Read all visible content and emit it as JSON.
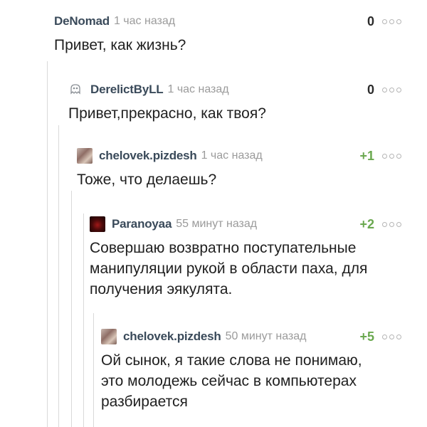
{
  "comments": [
    {
      "username": "DeNomad",
      "time": "1 час назад",
      "rating": "0",
      "text": "Привет, как жизнь?",
      "avatar": "none"
    },
    {
      "username": "DerelictByLL",
      "time": "1 час назад",
      "rating": "0",
      "text": "Привет,прекрасно, как твоя?",
      "avatar": "ghost-icon"
    },
    {
      "username": "chelovek.pizdesh",
      "time": "1 час назад",
      "rating": "+1",
      "text": "Тоже, что делаешь?",
      "avatar": "photo-avatar"
    },
    {
      "username": "Paranoyaa",
      "time": "55 минут назад",
      "rating": "+2",
      "text": "Совершаю возвратно поступательные\nманипуляции рукой в области паха,  для\nполучения эякулята.",
      "avatar": "dark-avatar"
    },
    {
      "username": "chelovek.pizdesh",
      "time": "50 минут назад",
      "rating": "+5",
      "text": "Ой сынок, я такие слова не понимаю,\nэто молодежь сейчас в компьютерах\nразбирается",
      "avatar": "photo-avatar"
    }
  ],
  "colors": {
    "username": "#3a4a5a",
    "timestamp": "#9b9b9b",
    "positive_rating": "#6aa84f",
    "thread_line": "#d9d9d9"
  }
}
